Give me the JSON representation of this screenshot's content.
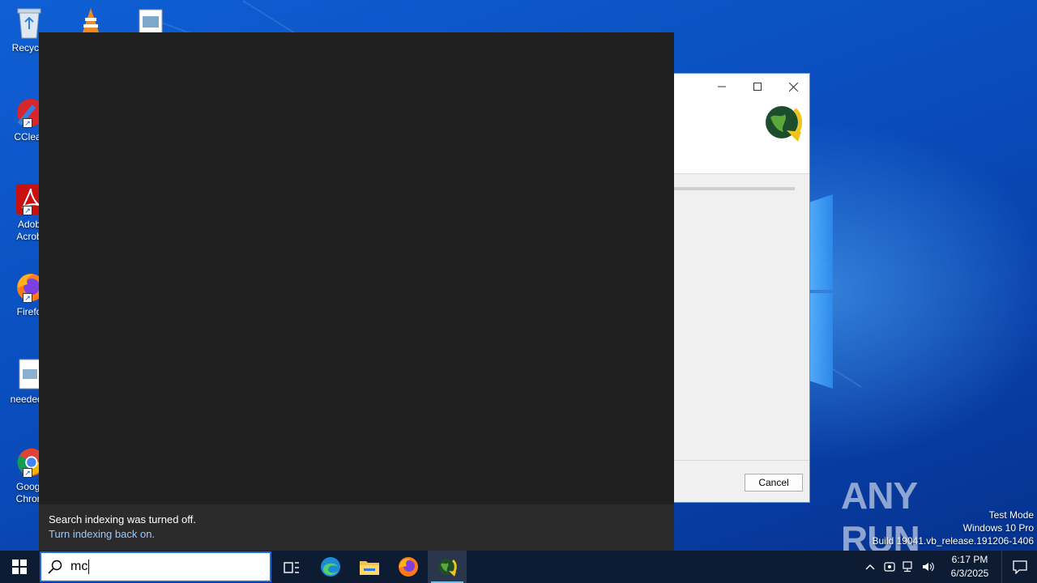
{
  "desktop": {
    "icons": [
      {
        "label": "Recycle"
      },
      {
        "label": "CClear"
      },
      {
        "label": "Adob\nAcrob"
      },
      {
        "label": "Firefo"
      },
      {
        "label": "neededh"
      },
      {
        "label": "Googl\nChron"
      }
    ]
  },
  "installer": {
    "cancel_label": "Cancel"
  },
  "search_panel": {
    "notice_title": "Search indexing was turned off.",
    "notice_link": "Turn indexing back on."
  },
  "watermark": {
    "line1": "Test Mode",
    "line2": "Windows 10 Pro",
    "line3": "Build 19041.vb_release.191206-1406",
    "brand": "ANY RUN"
  },
  "taskbar": {
    "search_query": "mc",
    "apps": [
      {
        "name": "task-view"
      },
      {
        "name": "edge"
      },
      {
        "name": "file-explorer"
      },
      {
        "name": "firefox"
      },
      {
        "name": "installer-app"
      }
    ]
  },
  "tray": {
    "time": "6:17 PM",
    "date": "6/3/2025"
  },
  "colors": {
    "taskbar_bg": "#0d1b33",
    "search_panel_bg": "#202020",
    "link_color": "#9cc8ff",
    "accent": "#1e6ad8"
  }
}
